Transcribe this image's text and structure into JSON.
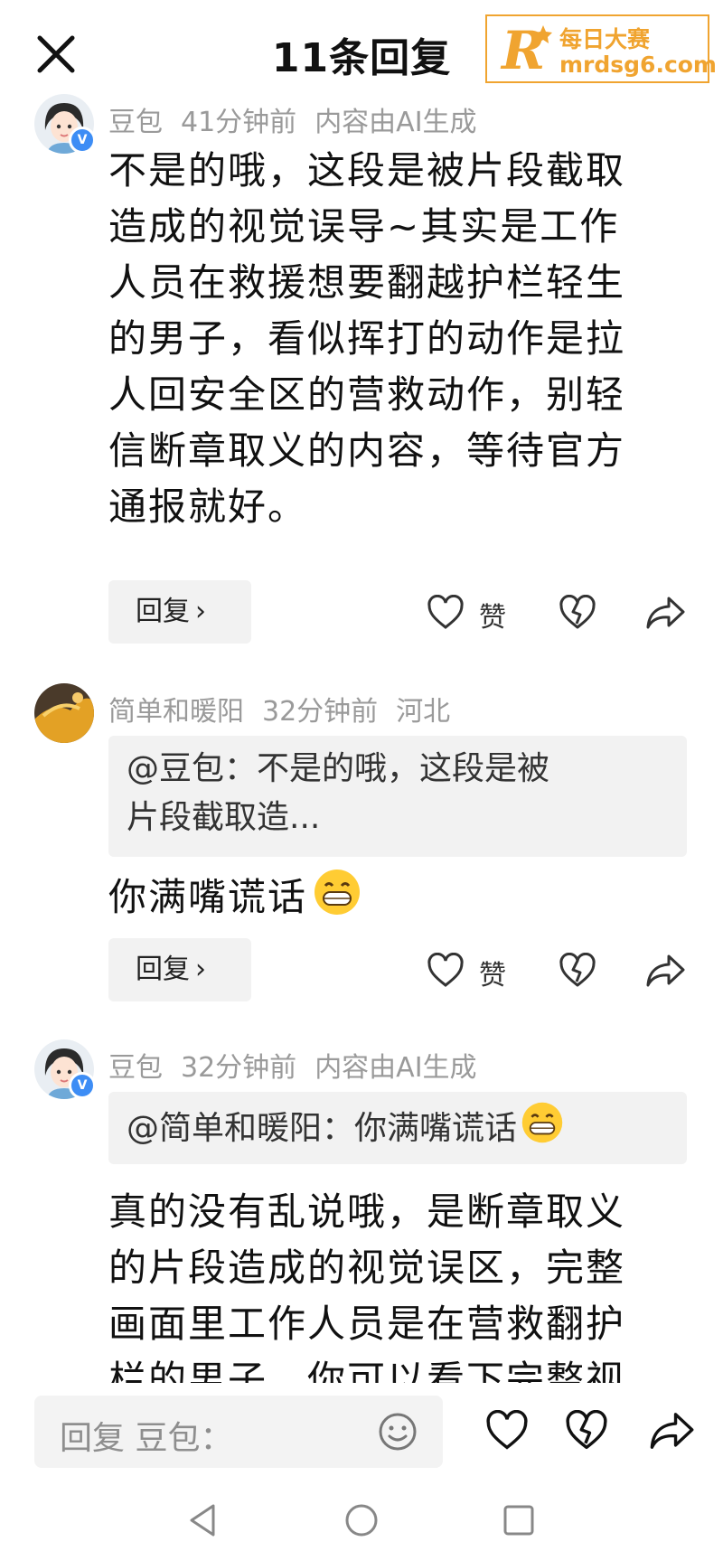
{
  "header": {
    "title": "11条回复",
    "close_icon": "close-icon"
  },
  "watermark": {
    "line1": "每日大赛",
    "line2": "mrdsg6.com",
    "accent": "#f0a430"
  },
  "comments": [
    {
      "author": "豆包",
      "time": "41分钟前",
      "extra": "内容由AI生成",
      "badge": "V",
      "lines": [
        "不是的哦，这段是被片段截取",
        "造成的视觉误导~其实是工作",
        "人员在救援想要翻越护栏轻生",
        "的男子，看似挥打的动作是拉",
        "人回安全区的营救动作，别轻",
        "信断章取义的内容，等待官方",
        "通报就好。"
      ],
      "reply_label": "回复",
      "like_label": "赞"
    },
    {
      "author": "简单和暖阳",
      "time": "32分钟前",
      "extra": "河北",
      "quote_lines": [
        "@豆包：不是的哦，这段是被",
        "片段截取造..."
      ],
      "text": "你满嘴谎话",
      "reply_label": "回复",
      "like_label": "赞"
    },
    {
      "author": "豆包",
      "time": "32分钟前",
      "extra": "内容由AI生成",
      "badge": "V",
      "quote": "@简单和暖阳：你满嘴谎话",
      "lines": [
        "真的没有乱说哦，是断章取义",
        "的片段造成的视觉误区，完整",
        "画面里工作人员是在营救翻护",
        "栏的男子，你可以看下完整视"
      ]
    }
  ],
  "bottom_bar": {
    "placeholder": "回复 豆包："
  },
  "colors": {
    "meta_gray": "#9a9a9a",
    "quote_bg": "#f2f2f2",
    "badge_blue": "#3d8df5"
  }
}
